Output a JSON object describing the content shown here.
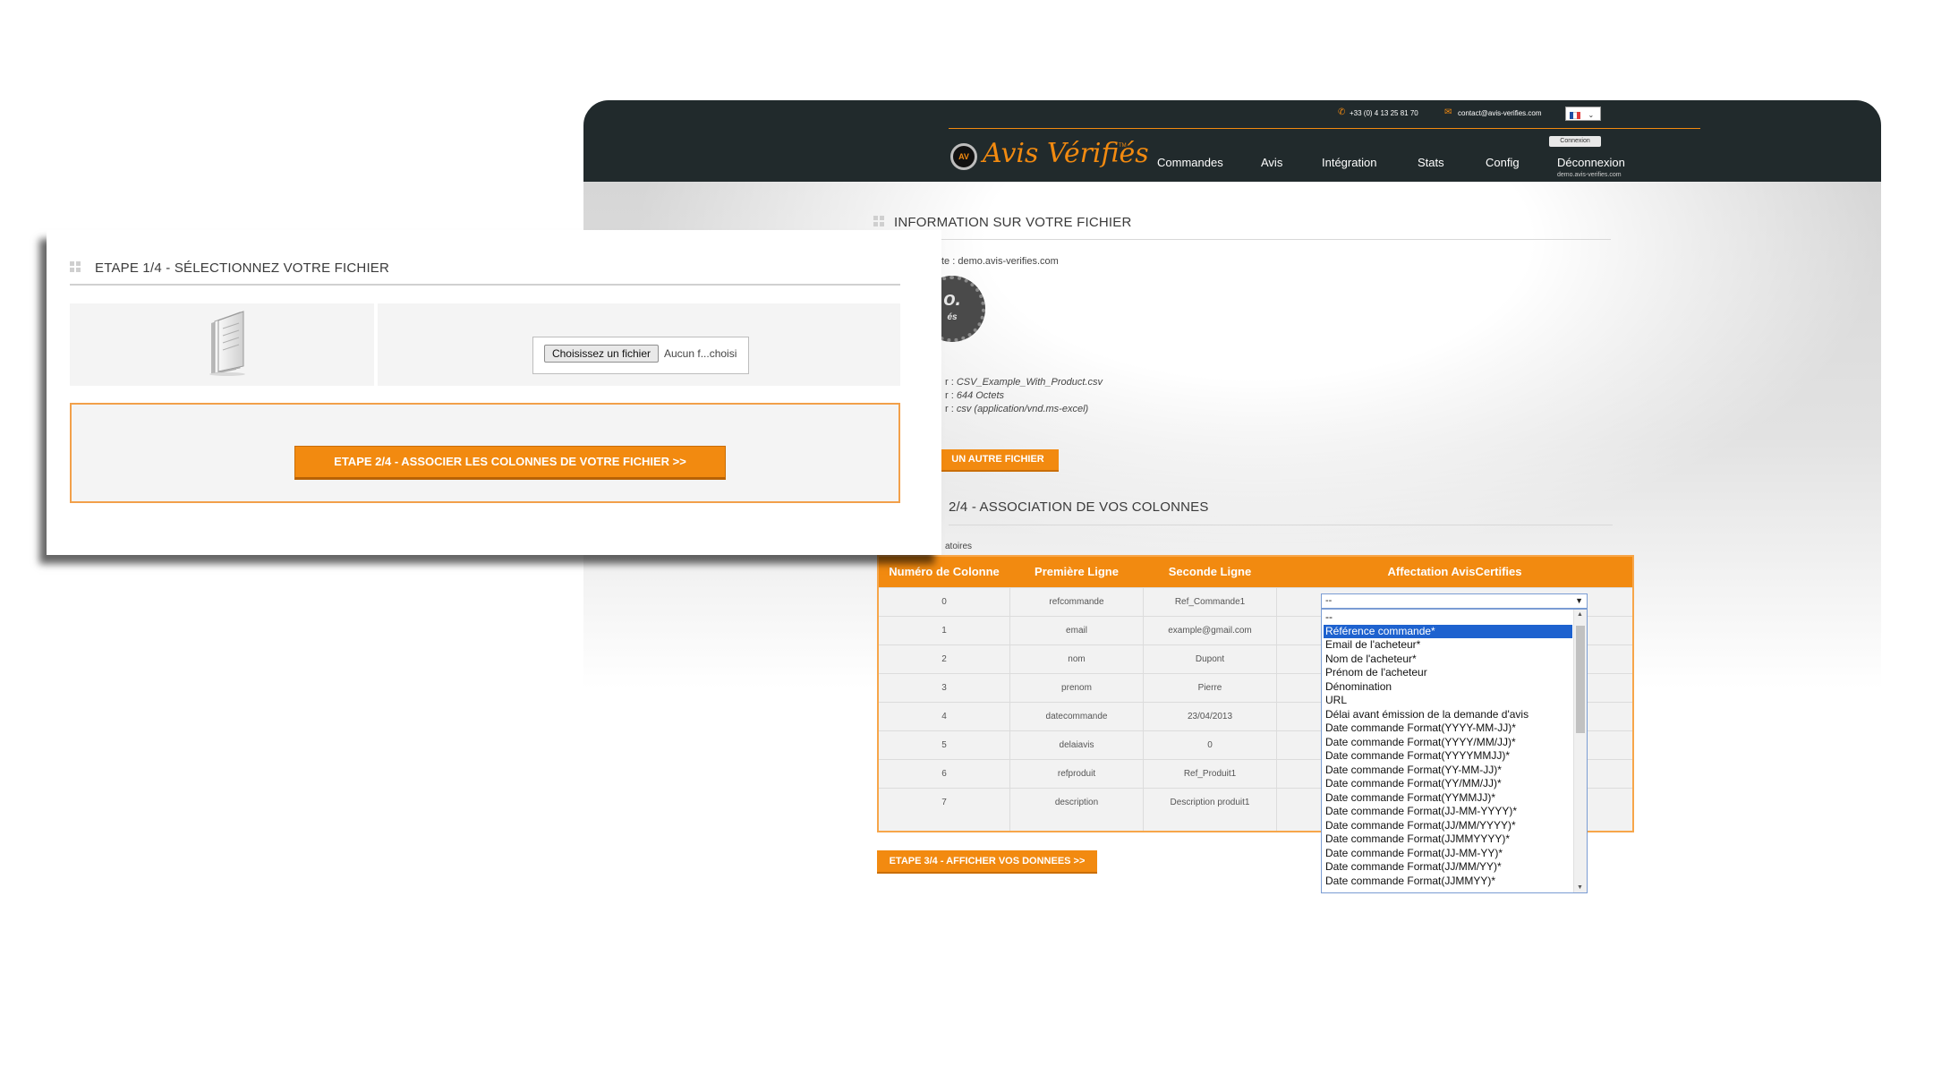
{
  "header": {
    "phone": "+33 (0) 4 13 25 81 70",
    "email": "contact@avis-verifies.com",
    "language_label": "FR",
    "connexion_label": "Connexion",
    "logo_text": "Avis Vérifiés",
    "logo_tm": "TM",
    "logo_badge_text": "AV",
    "nav": [
      "Commandes",
      "Avis",
      "Intégration",
      "Stats",
      "Config",
      "Déconnexion"
    ],
    "account_site": "demo.avis-verifies.com"
  },
  "info_section": {
    "title": "INFORMATION SUR VOTRE FICHIER",
    "site_line_label": "te :",
    "site_line_value": "demo.avis-verifies.com",
    "seal_text": "o.",
    "seal_subtext": "és",
    "file_name_label": "r :",
    "file_name_value": "CSV_Example_With_Product.csv",
    "file_size_label": "r :",
    "file_size_value": "644 Octets",
    "file_type_label": "r :",
    "file_type_value": "csv (application/vnd.ms-excel)",
    "other_file_button": "UN AUTRE FICHIER"
  },
  "assoc_section": {
    "title": "2/4 - ASSOCIATION DE VOS COLONNES",
    "required_note": "atoires",
    "columns": [
      "Numéro de Colonne",
      "Première Ligne",
      "Seconde Ligne",
      "Affectation AvisCertifies"
    ],
    "rows": [
      [
        "0",
        "refcommande",
        "Ref_Commande1"
      ],
      [
        "1",
        "email",
        "example@gmail.com"
      ],
      [
        "2",
        "nom",
        "Dupont"
      ],
      [
        "3",
        "prenom",
        "Pierre"
      ],
      [
        "4",
        "datecommande",
        "23/04/2013"
      ],
      [
        "5",
        "delaiavis",
        "0"
      ],
      [
        "6",
        "refproduit",
        "Ref_Produit1"
      ],
      [
        "7",
        "description",
        "Description produit1"
      ]
    ],
    "step3_button": "ETAPE 3/4 - AFFICHER VOS DONNEES >>"
  },
  "dropdown": {
    "selected_value": "--",
    "highlighted_index": 1,
    "options": [
      "--",
      "Référence commande*",
      "Email de l'acheteur*",
      "Nom de l'acheteur*",
      "Prénom de l'acheteur",
      "Dénomination",
      "URL",
      "Délai avant émission de la demande d'avis",
      "Date commande Format(YYYY-MM-JJ)*",
      "Date commande Format(YYYY/MM/JJ)*",
      "Date commande Format(YYYYMMJJ)*",
      "Date commande Format(YY-MM-JJ)*",
      "Date commande Format(YY/MM/JJ)*",
      "Date commande Format(YYMMJJ)*",
      "Date commande Format(JJ-MM-YYYY)*",
      "Date commande Format(JJ/MM/YYYY)*",
      "Date commande Format(JJMMYYYY)*",
      "Date commande Format(JJ-MM-YY)*",
      "Date commande Format(JJ/MM/YY)*",
      "Date commande Format(JJMMYY)*"
    ]
  },
  "front_panel": {
    "title": "ETAPE 1/4 - SÉLECTIONNEZ VOTRE FICHIER",
    "choose_button": "Choisissez un fichier",
    "no_file_text": "Aucun f...choisi",
    "step2_button": "ETAPE 2/4 - ASSOCIER LES COLONNES DE VOTRE FICHIER >>"
  },
  "colors": {
    "accent": "#f28a10",
    "header_bg": "#212a2c",
    "selection": "#1e62cf"
  },
  "icons": {
    "phone": "phone-icon",
    "email": "envelope-icon",
    "file": "document-icon"
  }
}
